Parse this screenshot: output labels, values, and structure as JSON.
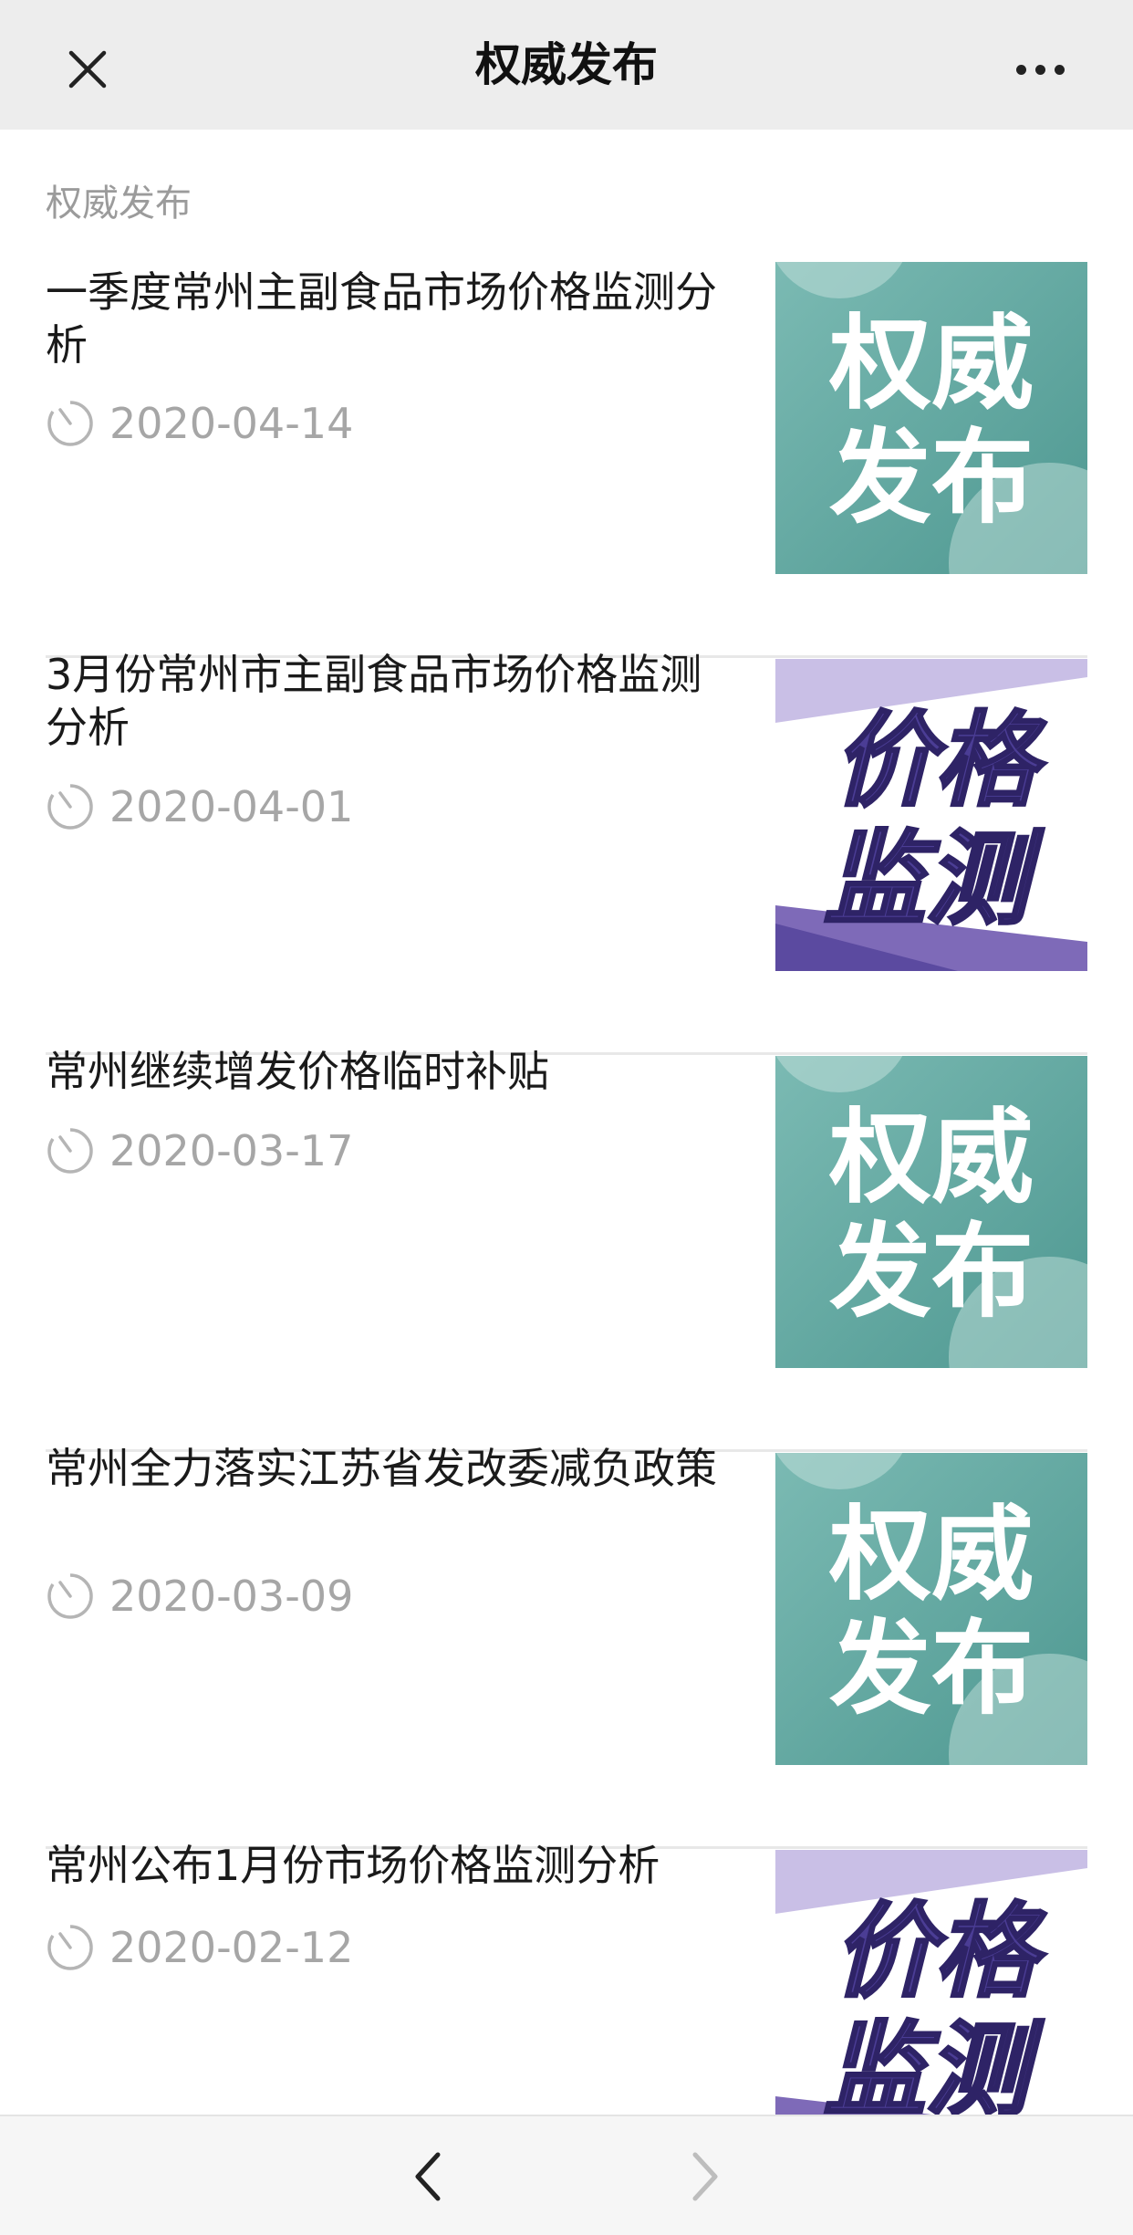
{
  "header": {
    "title": "权威发布",
    "close_icon": "close-icon",
    "more_icon": "more-dots-icon"
  },
  "section_label": "权威发布",
  "articles": [
    {
      "title": "一季度常州主副食品市场价格监测分析",
      "date": "2020-04-14",
      "thumb": {
        "kind": "authority",
        "line1": "权威",
        "line2": "发布"
      }
    },
    {
      "title": "3月份常州市主副食品市场价格监测分析",
      "date": "2020-04-01",
      "thumb": {
        "kind": "price",
        "line1": "价格",
        "line2": "监测"
      }
    },
    {
      "title": "常州继续增发价格临时补贴",
      "date": "2020-03-17",
      "thumb": {
        "kind": "authority",
        "line1": "权威",
        "line2": "发布"
      }
    },
    {
      "title": "常州全力落实江苏省发改委减负政策",
      "date": "2020-03-09",
      "thumb": {
        "kind": "authority",
        "line1": "权威",
        "line2": "发布"
      }
    },
    {
      "title": "常州公布1月份市场价格监测分析",
      "date": "2020-02-12",
      "thumb": {
        "kind": "price",
        "line1": "价格",
        "line2": "监测"
      }
    }
  ],
  "footer": {
    "back_icon": "chevron-left-icon",
    "forward_icon": "chevron-right-icon"
  },
  "colors": {
    "teal": "#5fa8a3",
    "purple": "#5b4aa0",
    "lavender": "#c9bfe6",
    "date_gray": "#a6a6a6"
  }
}
